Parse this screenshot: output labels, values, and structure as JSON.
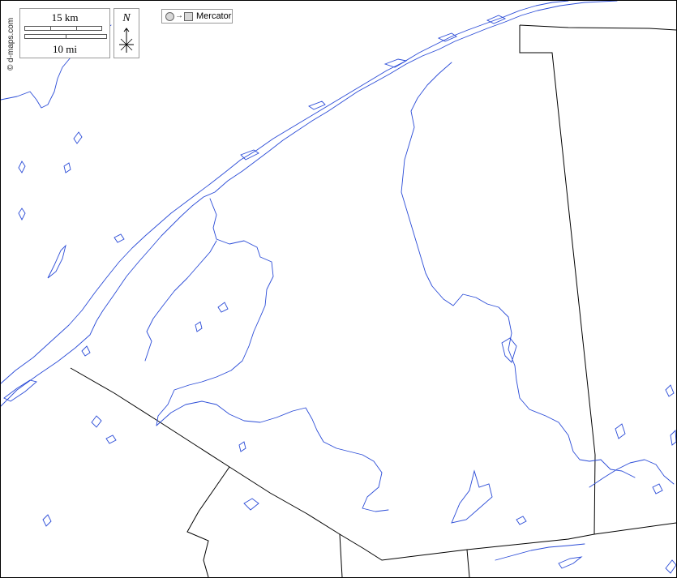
{
  "map": {
    "copyright": "© d-maps.com",
    "scale": {
      "km_label": "15 km",
      "mi_label": "10 mi"
    },
    "north_label": "N",
    "projection": {
      "label": "Mercator",
      "icon": "circle-to-square-icon"
    },
    "colors": {
      "water": "#2a4bd7",
      "borders": "#000000",
      "land": "#ffffff"
    }
  }
}
